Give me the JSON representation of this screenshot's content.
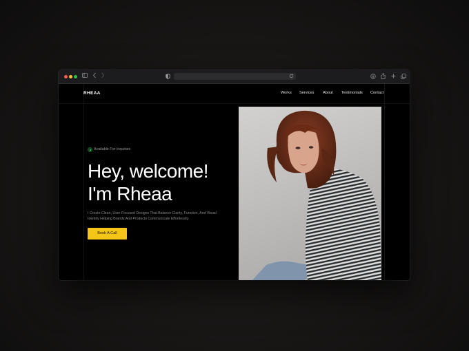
{
  "site": {
    "logo": "RHEAA",
    "nav": [
      "Works",
      "Services",
      "About",
      "Testimonials",
      "Contact"
    ]
  },
  "hero": {
    "badge": "Available For Inquiries",
    "headline_line1": "Hey, welcome!",
    "headline_line2": "I'm Rheaa",
    "description": "I Create Clean, User-Focused Designs That Balance Clarity, Function, And Visual Identity Helping Brands And Products Communicate Effortlessly.",
    "cta": "Book A Call"
  },
  "colors": {
    "accent": "#f5c518",
    "available": "#3ddc6a",
    "background": "#000000"
  }
}
